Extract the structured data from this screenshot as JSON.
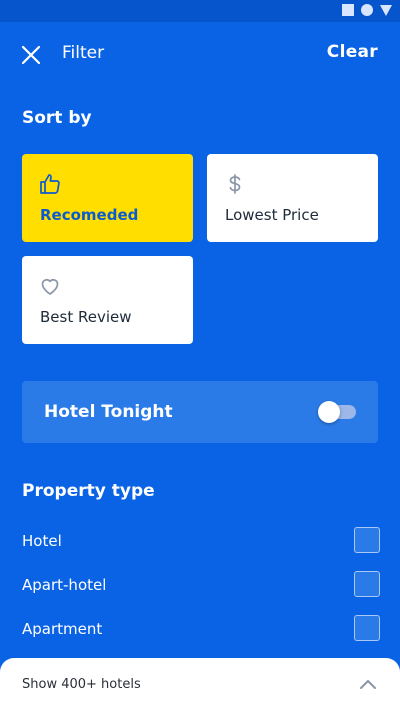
{
  "header": {
    "title": "Filter",
    "clear_label": "Clear"
  },
  "sort": {
    "title": "Sort by",
    "options": [
      {
        "label": "Recomeded",
        "icon": "thumbs-up-icon",
        "selected": true
      },
      {
        "label": "Lowest Price",
        "icon": "dollar-icon",
        "selected": false
      },
      {
        "label": "Best Review",
        "icon": "heart-icon",
        "selected": false
      }
    ]
  },
  "hotel_tonight": {
    "label": "Hotel Tonight",
    "enabled": false
  },
  "property": {
    "title": "Property type",
    "items": [
      {
        "label": "Hotel",
        "checked": false
      },
      {
        "label": "Apart-hotel",
        "checked": false
      },
      {
        "label": "Apartment",
        "checked": false
      }
    ]
  },
  "footer": {
    "label": "Show 400+ hotels"
  },
  "colors": {
    "background": "#0A63E5",
    "selected_card": "#FFDE00",
    "card": "#FFFFFF",
    "panel": "#2A7BE8"
  }
}
